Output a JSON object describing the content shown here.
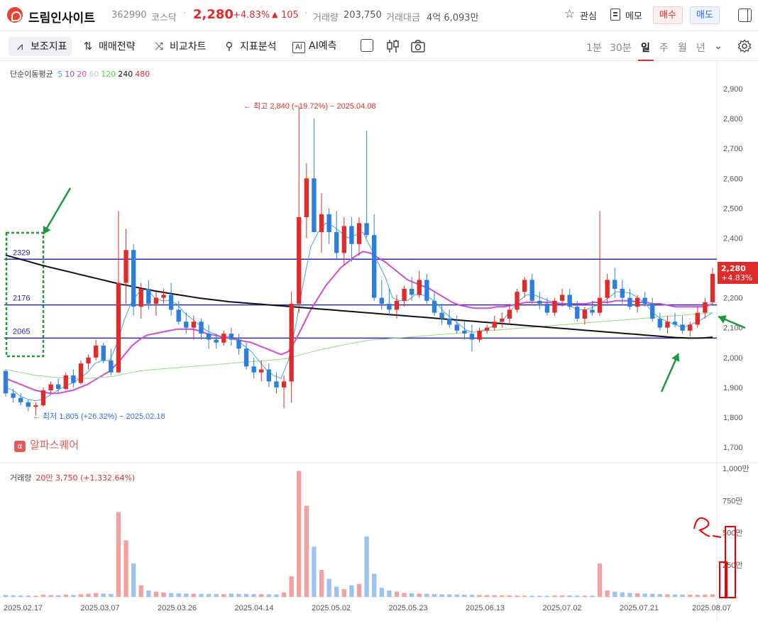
{
  "header": {
    "name": "드림인사이트",
    "code": "362990",
    "market": "코스닥",
    "price": "2,280",
    "change_pct": "+4.83%",
    "change_arrow": "▲",
    "change_abs": "105",
    "volume_label": "거래량",
    "volume": "203,750",
    "amount_label": "거래대금",
    "amount": "4억 6,093만",
    "watch_label": "관심",
    "memo_label": "메모",
    "buy_label": "매수",
    "sell_label": "매도"
  },
  "toolbar": {
    "indicators": "보조지표",
    "strategy": "매매전략",
    "compare": "비교차트",
    "analysis": "지표분석",
    "ai": "AI예측",
    "periods": [
      "1분",
      "30분",
      "일",
      "주",
      "월",
      "년"
    ],
    "selected_period": "일"
  },
  "legend": {
    "ma_title": "단순이동평균",
    "ma_periods": [
      {
        "label": "5",
        "color": "#4aa3e0"
      },
      {
        "label": "10",
        "color": "#6a5acd"
      },
      {
        "label": "20",
        "color": "#d04bd8"
      },
      {
        "label": "60",
        "color": "#c8c8c8"
      },
      {
        "label": "120",
        "color": "#5ccf4a"
      },
      {
        "label": "240",
        "color": "#111111"
      },
      {
        "label": "480",
        "color": "#e02b2b"
      }
    ],
    "volume_title": "거래량",
    "volume_value": "20만 3,750 (+1,332.64%)"
  },
  "annotations": {
    "high": "최고 2,840 (−19.72%) − 2025.04.08",
    "low": "최저 1,805 (+26.32%) − 2025.02.18",
    "levels": [
      "2329",
      "2176",
      "2065"
    ],
    "watermark": "알파스퀘어",
    "watermark_logo": "α"
  },
  "price_tag": {
    "price": "2,280",
    "pct": "+4.83%"
  },
  "y_axis": [
    "2,900",
    "2,800",
    "2,700",
    "2,600",
    "2,500",
    "2,400",
    "2,300",
    "2,200",
    "2,100",
    "2,000",
    "1,900",
    "1,800",
    "1,700"
  ],
  "vol_axis": [
    "1,000만",
    "750만",
    "500만",
    "250만"
  ],
  "x_axis": [
    "2025.02.17",
    "2025.03.07",
    "2025.03.26",
    "2025.04.14",
    "2025.05.02",
    "2025.05.23",
    "2025.06.13",
    "2025.07.02",
    "2025.07.21",
    "2025.08.07"
  ],
  "colors": {
    "up": "#e02b2b",
    "down": "#2b7de0",
    "vol_up": "#f2a0a0",
    "vol_down": "#9cc3ef",
    "level_line": "#2a2ab8"
  },
  "chart_data": {
    "type": "candlestick",
    "x_axis_labels": [
      "2025.02.17",
      "2025.03.07",
      "2025.03.26",
      "2025.04.14",
      "2025.05.02",
      "2025.05.23",
      "2025.06.13",
      "2025.07.02",
      "2025.07.21",
      "2025.08.07"
    ],
    "ylim": [
      1700,
      2930
    ],
    "volume_ylim": [
      0,
      10000000
    ],
    "candles": [
      [
        1955,
        1960,
        1870,
        1880
      ],
      [
        1880,
        1895,
        1850,
        1865
      ],
      [
        1865,
        1880,
        1840,
        1850
      ],
      [
        1850,
        1860,
        1820,
        1835
      ],
      [
        1835,
        1850,
        1805,
        1840
      ],
      [
        1840,
        1900,
        1835,
        1890
      ],
      [
        1890,
        1920,
        1880,
        1910
      ],
      [
        1910,
        1930,
        1880,
        1895
      ],
      [
        1895,
        1950,
        1890,
        1940
      ],
      [
        1940,
        1960,
        1900,
        1915
      ],
      [
        1915,
        1990,
        1910,
        1980
      ],
      [
        1980,
        2010,
        1960,
        2000
      ],
      [
        2000,
        2060,
        1990,
        2040
      ],
      [
        2040,
        2050,
        1980,
        1990
      ],
      [
        1990,
        2030,
        1940,
        1950
      ],
      [
        1950,
        2490,
        1950,
        2250
      ],
      [
        2250,
        2430,
        2180,
        2360
      ],
      [
        2360,
        2380,
        2140,
        2170
      ],
      [
        2170,
        2250,
        2130,
        2230
      ],
      [
        2230,
        2260,
        2160,
        2180
      ],
      [
        2180,
        2220,
        2140,
        2200
      ],
      [
        2200,
        2230,
        2180,
        2210
      ],
      [
        2210,
        2250,
        2140,
        2160
      ],
      [
        2160,
        2190,
        2110,
        2120
      ],
      [
        2120,
        2150,
        2080,
        2100
      ],
      [
        2100,
        2140,
        2060,
        2120
      ],
      [
        2120,
        2130,
        2060,
        2080
      ],
      [
        2080,
        2110,
        2030,
        2060
      ],
      [
        2060,
        2080,
        2030,
        2050
      ],
      [
        2050,
        2090,
        2040,
        2080
      ],
      [
        2080,
        2100,
        2040,
        2060
      ],
      [
        2060,
        2080,
        2010,
        2030
      ],
      [
        2030,
        2050,
        1960,
        1970
      ],
      [
        1970,
        2000,
        1930,
        1950
      ],
      [
        1950,
        1990,
        1920,
        1960
      ],
      [
        1960,
        1980,
        1900,
        1920
      ],
      [
        1920,
        1950,
        1880,
        1900
      ],
      [
        1900,
        1940,
        1830,
        1920
      ],
      [
        1920,
        2220,
        1850,
        2180
      ],
      [
        2180,
        2840,
        2150,
        2470
      ],
      [
        2470,
        2650,
        2400,
        2600
      ],
      [
        2600,
        2800,
        2500,
        2420
      ],
      [
        2420,
        2550,
        2350,
        2480
      ],
      [
        2480,
        2500,
        2380,
        2420
      ],
      [
        2420,
        2490,
        2330,
        2350
      ],
      [
        2350,
        2470,
        2310,
        2440
      ],
      [
        2440,
        2470,
        2320,
        2380
      ],
      [
        2380,
        2470,
        2340,
        2450
      ],
      [
        2450,
        2760,
        2400,
        2410
      ],
      [
        2410,
        2480,
        2190,
        2200
      ],
      [
        2200,
        2260,
        2160,
        2180
      ],
      [
        2180,
        2230,
        2140,
        2160
      ],
      [
        2160,
        2210,
        2130,
        2190
      ],
      [
        2190,
        2240,
        2170,
        2230
      ],
      [
        2230,
        2270,
        2190,
        2210
      ],
      [
        2210,
        2290,
        2200,
        2260
      ],
      [
        2260,
        2280,
        2180,
        2190
      ],
      [
        2190,
        2220,
        2140,
        2150
      ],
      [
        2150,
        2180,
        2110,
        2130
      ],
      [
        2130,
        2160,
        2100,
        2110
      ],
      [
        2110,
        2140,
        2080,
        2090
      ],
      [
        2090,
        2120,
        2060,
        2080
      ],
      [
        2080,
        2110,
        2020,
        2060
      ],
      [
        2060,
        2100,
        2050,
        2090
      ],
      [
        2090,
        2110,
        2080,
        2100
      ],
      [
        2100,
        2140,
        2090,
        2120
      ],
      [
        2120,
        2150,
        2100,
        2130
      ],
      [
        2130,
        2180,
        2110,
        2160
      ],
      [
        2160,
        2230,
        2150,
        2220
      ],
      [
        2220,
        2270,
        2200,
        2260
      ],
      [
        2260,
        2280,
        2180,
        2190
      ],
      [
        2190,
        2220,
        2160,
        2180
      ],
      [
        2180,
        2200,
        2140,
        2150
      ],
      [
        2150,
        2200,
        2140,
        2190
      ],
      [
        2190,
        2230,
        2170,
        2210
      ],
      [
        2210,
        2230,
        2160,
        2170
      ],
      [
        2170,
        2190,
        2120,
        2130
      ],
      [
        2130,
        2170,
        2110,
        2160
      ],
      [
        2160,
        2190,
        2140,
        2150
      ],
      [
        2150,
        2490,
        2140,
        2200
      ],
      [
        2200,
        2280,
        2180,
        2260
      ],
      [
        2260,
        2300,
        2200,
        2230
      ],
      [
        2230,
        2260,
        2180,
        2200
      ],
      [
        2200,
        2230,
        2160,
        2170
      ],
      [
        2170,
        2210,
        2150,
        2200
      ],
      [
        2200,
        2220,
        2170,
        2180
      ],
      [
        2180,
        2200,
        2120,
        2130
      ],
      [
        2130,
        2150,
        2090,
        2100
      ],
      [
        2100,
        2140,
        2080,
        2120
      ],
      [
        2120,
        2150,
        2100,
        2110
      ],
      [
        2110,
        2140,
        2080,
        2090
      ],
      [
        2090,
        2120,
        2070,
        2110
      ],
      [
        2110,
        2170,
        2100,
        2150
      ],
      [
        2150,
        2200,
        2130,
        2185
      ],
      [
        2185,
        2300,
        2180,
        2280
      ]
    ],
    "volumes": [
      150000,
      120000,
      100000,
      110000,
      90000,
      160000,
      140000,
      120000,
      180000,
      150000,
      200000,
      250000,
      300000,
      260000,
      220000,
      6600000,
      4400000,
      2600000,
      900000,
      500000,
      400000,
      350000,
      300000,
      280000,
      260000,
      250000,
      240000,
      230000,
      220000,
      210000,
      260000,
      240000,
      230000,
      220000,
      210000,
      200000,
      190000,
      350000,
      1600000,
      9800000,
      7100000,
      3900000,
      2100000,
      1400000,
      800000,
      600000,
      900000,
      1000000,
      4700000,
      1800000,
      700000,
      500000,
      400000,
      300000,
      280000,
      260000,
      240000,
      220000,
      200000,
      190000,
      180000,
      170000,
      160000,
      150000,
      140000,
      130000,
      120000,
      110000,
      100000,
      95000,
      90000,
      85000,
      80000,
      100000,
      120000,
      110000,
      100000,
      90000,
      95000,
      2600000,
      500000,
      400000,
      350000,
      300000,
      280000,
      260000,
      240000,
      220000,
      200000,
      190000,
      180000,
      170000,
      160000,
      180000,
      200000,
      203750
    ],
    "moving_averages": {
      "5": [
        1900,
        1890,
        1870,
        1860,
        1855,
        1860,
        1875,
        1890,
        1905,
        1915,
        1930,
        1950,
        1980,
        1990,
        1990,
        2050,
        2130,
        2190,
        2220,
        2230,
        2200,
        2190,
        2190,
        2180,
        2150,
        2130,
        2110,
        2090,
        2080,
        2070,
        2070,
        2060,
        2040,
        2020,
        1990,
        1960,
        1940,
        1930,
        1990,
        2110,
        2250,
        2370,
        2420,
        2450,
        2440,
        2420,
        2400,
        2410,
        2420,
        2370,
        2320,
        2270,
        2200,
        2190,
        2190,
        2210,
        2210,
        2200,
        2180,
        2150,
        2130,
        2110,
        2090,
        2085,
        2090,
        2100,
        2110,
        2130,
        2160,
        2190,
        2210,
        2210,
        2200,
        2190,
        2185,
        2180,
        2170,
        2160,
        2160,
        2170,
        2180,
        2200,
        2220,
        2220,
        2215,
        2200,
        2180,
        2150,
        2130,
        2120,
        2110,
        2100,
        2110,
        2120,
        2135,
        2150
      ],
      "20": [
        1930,
        1920,
        1910,
        1900,
        1890,
        1885,
        1880,
        1880,
        1885,
        1890,
        1900,
        1910,
        1925,
        1940,
        1955,
        1980,
        2010,
        2040,
        2060,
        2075,
        2080,
        2085,
        2090,
        2095,
        2095,
        2095,
        2090,
        2080,
        2075,
        2070,
        2065,
        2060,
        2055,
        2050,
        2040,
        2030,
        2020,
        2010,
        2020,
        2060,
        2110,
        2160,
        2200,
        2240,
        2270,
        2300,
        2320,
        2340,
        2355,
        2350,
        2335,
        2320,
        2300,
        2280,
        2260,
        2250,
        2240,
        2230,
        2215,
        2200,
        2185,
        2175,
        2170,
        2165,
        2165,
        2165,
        2170,
        2170,
        2175,
        2180,
        2185,
        2185,
        2185,
        2185,
        2180,
        2180,
        2180,
        2180,
        2180,
        2185,
        2185,
        2185,
        2190,
        2190,
        2190,
        2185,
        2185,
        2180,
        2180,
        2175,
        2170,
        2170,
        2170,
        2170,
        2170,
        2180
      ],
      "120": [
        1960,
        1955,
        1950,
        1945,
        1940,
        1938,
        1935,
        1933,
        1932,
        1930,
        1930,
        1930,
        1932,
        1934,
        1936,
        1940,
        1945,
        1950,
        1955,
        1958,
        1960,
        1962,
        1964,
        1966,
        1968,
        1970,
        1972,
        1974,
        1976,
        1978,
        1980,
        1982,
        1984,
        1986,
        1988,
        1990,
        1992,
        1994,
        1998,
        2005,
        2012,
        2018,
        2024,
        2030,
        2035,
        2040,
        2045,
        2050,
        2055,
        2058,
        2060,
        2062,
        2064,
        2066,
        2068,
        2070,
        2072,
        2074,
        2076,
        2078,
        2080,
        2082,
        2084,
        2086,
        2088,
        2090,
        2092,
        2094,
        2096,
        2098,
        2100,
        2102,
        2104,
        2106,
        2108,
        2110,
        2112,
        2114,
        2116,
        2118,
        2120,
        2122,
        2124,
        2126,
        2128,
        2130,
        2132,
        2134,
        2136,
        2138,
        2140,
        2142,
        2144,
        2146,
        2148,
        2150
      ],
      "240": [
        2343,
        2336,
        2329,
        2322,
        2315,
        2308,
        2302,
        2296,
        2290,
        2284,
        2278,
        2272,
        2266,
        2260,
        2254,
        2248,
        2243,
        2238,
        2233,
        2228,
        2223,
        2219,
        2215,
        2211,
        2207,
        2203,
        2199,
        2196,
        2193,
        2190,
        2187,
        2185,
        2183,
        2181,
        2179,
        2177,
        2175,
        2173,
        2171,
        2169,
        2167,
        2165,
        2163,
        2161,
        2159,
        2157,
        2155,
        2153,
        2151,
        2149,
        2147,
        2145,
        2143,
        2141,
        2139,
        2137,
        2135,
        2133,
        2131,
        2129,
        2127,
        2125,
        2123,
        2121,
        2119,
        2117,
        2115,
        2113,
        2111,
        2109,
        2107,
        2105,
        2103,
        2101,
        2099,
        2097,
        2095,
        2093,
        2091,
        2089,
        2087,
        2085,
        2083,
        2081,
        2079,
        2077,
        2075,
        2073,
        2071,
        2069,
        2067,
        2066,
        2065,
        2065,
        2066,
        2068
      ]
    },
    "horizontal_levels": [
      2329,
      2176,
      2065
    ]
  }
}
